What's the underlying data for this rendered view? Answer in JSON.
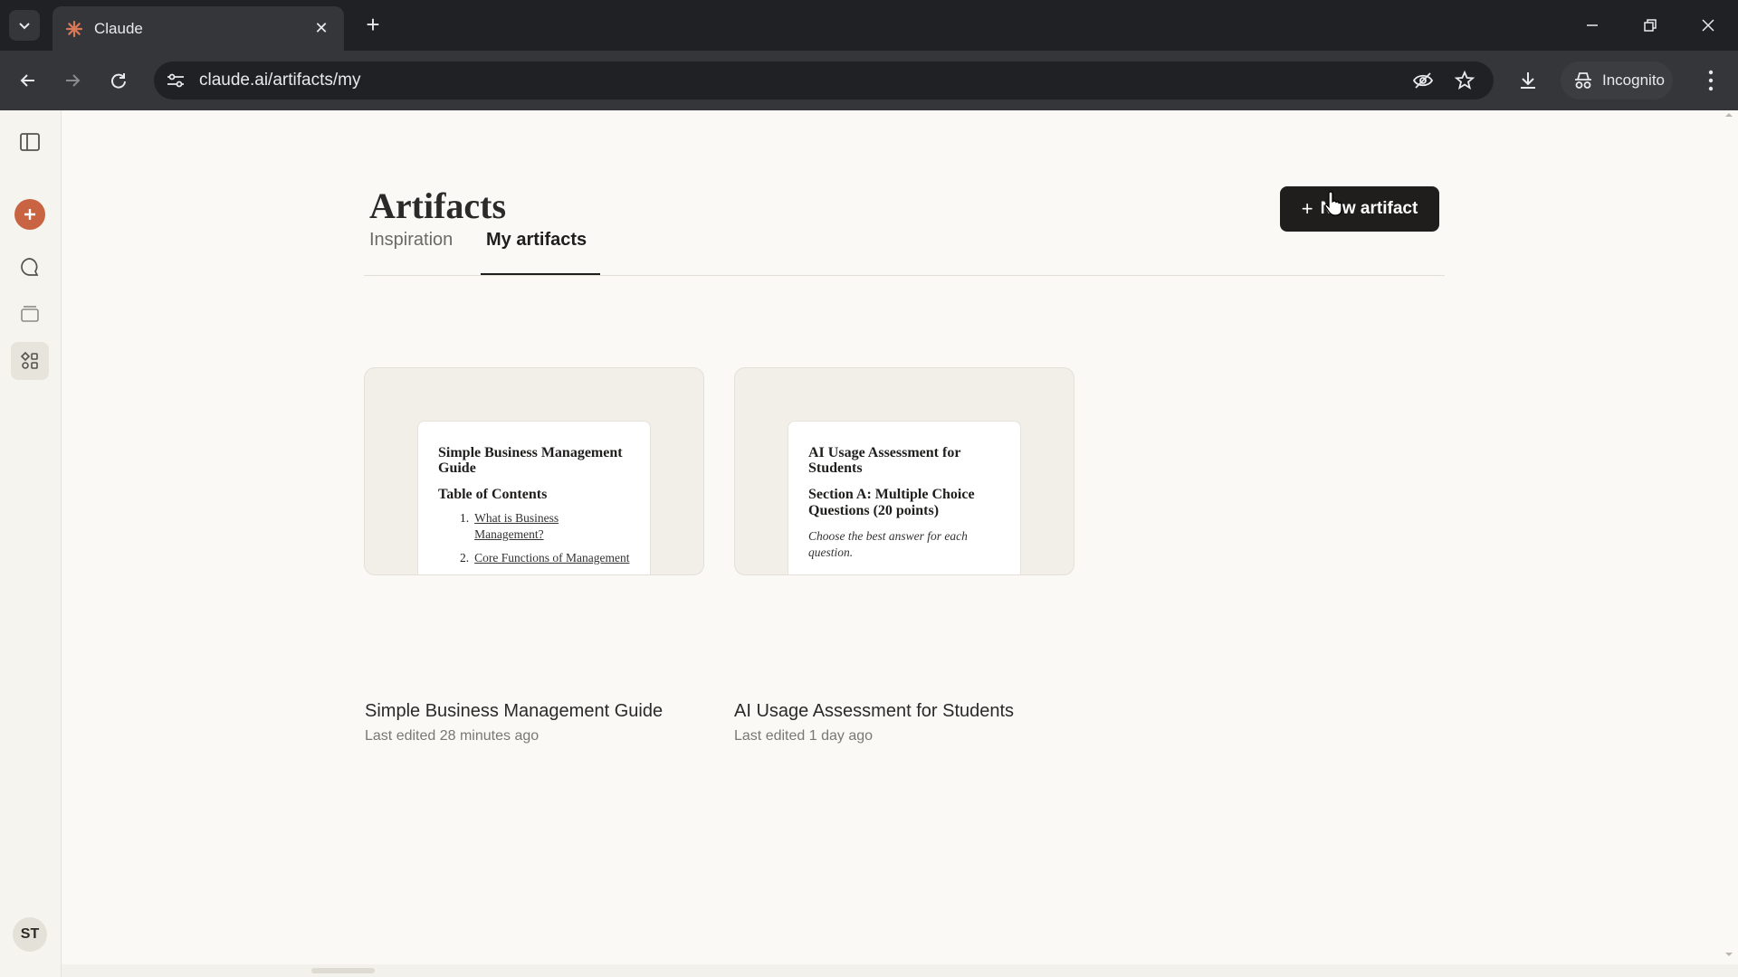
{
  "browser": {
    "tab_title": "Claude",
    "url": "claude.ai/artifacts/my",
    "profile_label": "Incognito"
  },
  "sidebar": {
    "avatar_initials": "ST",
    "accent_color": "#c96442"
  },
  "main": {
    "title": "Artifacts",
    "new_artifact_label": "New artifact",
    "tabs": [
      {
        "label": "Inspiration",
        "active": false
      },
      {
        "label": "My artifacts",
        "active": true
      }
    ],
    "artifacts": [
      {
        "title": "Simple Business Management Guide",
        "meta": "Last edited 28 minutes ago",
        "preview": {
          "title": "Simple Business Management Guide",
          "heading": "Table of Contents",
          "items": [
            {
              "num": "1.",
              "text": "What is Business Management?"
            },
            {
              "num": "2.",
              "text": "Core Functions of Management"
            }
          ]
        }
      },
      {
        "title": "AI Usage Assessment for Students",
        "meta": "Last edited 1 day ago",
        "preview": {
          "title": "AI Usage Assessment for Students",
          "heading": "Section A: Multiple Choice Questions (20 points)",
          "note": "Choose the best answer for each question."
        }
      }
    ]
  }
}
